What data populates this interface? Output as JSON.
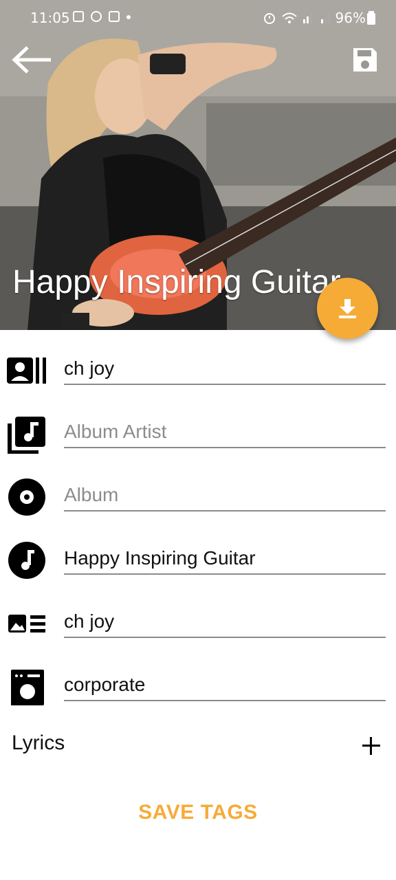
{
  "status_bar": {
    "time": "11:05",
    "battery": "96%"
  },
  "header": {
    "title": "Happy Inspiring Guitar"
  },
  "fields": {
    "artist": {
      "value": "ch joy",
      "placeholder": ""
    },
    "album_artist": {
      "value": "",
      "placeholder": "Album Artist"
    },
    "album": {
      "value": "",
      "placeholder": "Album"
    },
    "title": {
      "value": "Happy Inspiring Guitar",
      "placeholder": ""
    },
    "composer": {
      "value": "ch joy",
      "placeholder": ""
    },
    "genre": {
      "value": "corporate",
      "placeholder": ""
    }
  },
  "lyrics": {
    "label": "Lyrics"
  },
  "actions": {
    "save_tags": "SAVE TAGS"
  },
  "colors": {
    "accent": "#f6ab37"
  }
}
